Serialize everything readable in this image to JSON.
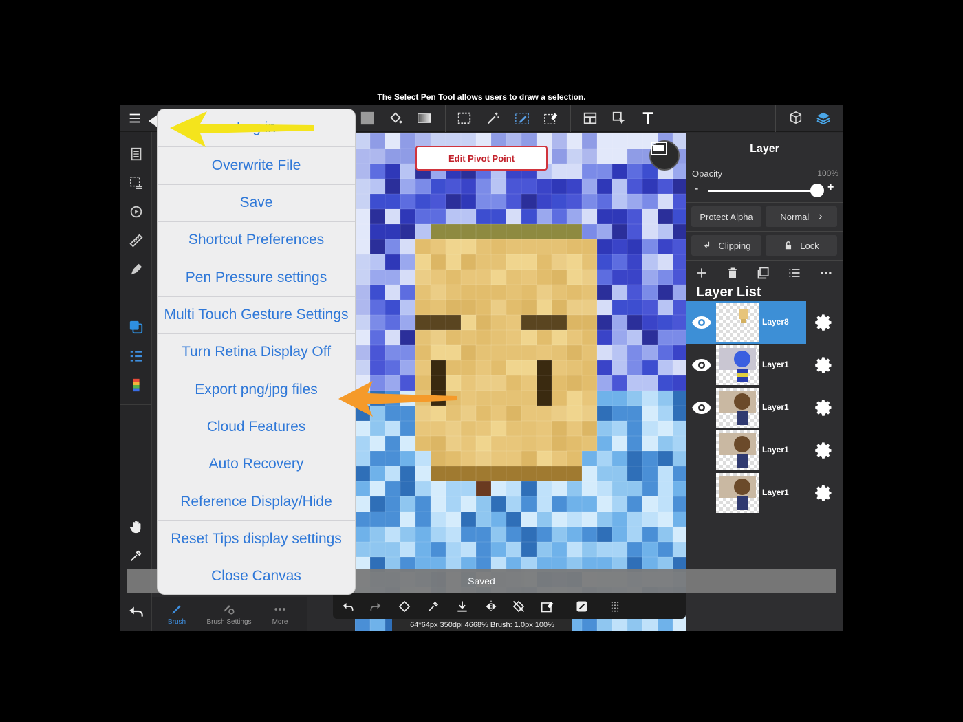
{
  "tip": "The Select Pen Tool allows users to draw a selection.",
  "menu": {
    "items": [
      {
        "name": "menu-log-in",
        "label": "Log in"
      },
      {
        "name": "menu-overwrite-file",
        "label": "Overwrite File"
      },
      {
        "name": "menu-save",
        "label": "Save"
      },
      {
        "name": "menu-shortcut-preferences",
        "label": "Shortcut Preferences"
      },
      {
        "name": "menu-pen-pressure-settings",
        "label": "Pen Pressure settings"
      },
      {
        "name": "menu-multi-touch-gesture-settings",
        "label": "Multi Touch Gesture Settings"
      },
      {
        "name": "menu-turn-retina-display-off",
        "label": "Turn Retina Display Off"
      },
      {
        "name": "menu-export-png-jpg-files",
        "label": "Export png/jpg files"
      },
      {
        "name": "menu-cloud-features",
        "label": "Cloud Features"
      },
      {
        "name": "menu-auto-recovery",
        "label": "Auto Recovery"
      },
      {
        "name": "menu-reference-display-hide",
        "label": "Reference Display/Hide"
      },
      {
        "name": "menu-reset-tips-display-settings",
        "label": "Reset Tips display settings"
      },
      {
        "name": "menu-close-canvas",
        "label": "Close Canvas"
      }
    ]
  },
  "canvas": {
    "pivot_button": "Edit Pivot Point",
    "saved_message": "Saved",
    "status": "64*64px 350dpi 4668% Brush: 1.0px 100%"
  },
  "brush_tabs": {
    "brush": "Brush",
    "brush_settings": "Brush Settings",
    "more": "More"
  },
  "layer_panel": {
    "title": "Layer",
    "opacity_label": "Opacity",
    "opacity_value": "100%",
    "opacity_fraction": 1.0,
    "minus": "-",
    "plus": "+",
    "protect_alpha": "Protect Alpha",
    "blend_mode": "Normal",
    "clipping": "Clipping",
    "lock": "Lock",
    "list_title": "Layer List",
    "layers": [
      {
        "name": "Layer8",
        "selected": true,
        "visible": true
      },
      {
        "name": "Layer1",
        "selected": false,
        "visible": true
      },
      {
        "name": "Layer1",
        "selected": false,
        "visible": true
      },
      {
        "name": "Layer1",
        "selected": false,
        "visible": false
      },
      {
        "name": "Layer1",
        "selected": false,
        "visible": false
      }
    ]
  },
  "colors": {
    "accent": "#3d8fd6",
    "menu_text": "#2f78d8",
    "pivot_red": "#c2202a",
    "arrow_yellow": "#f4e41c",
    "arrow_orange": "#f59a2a"
  }
}
